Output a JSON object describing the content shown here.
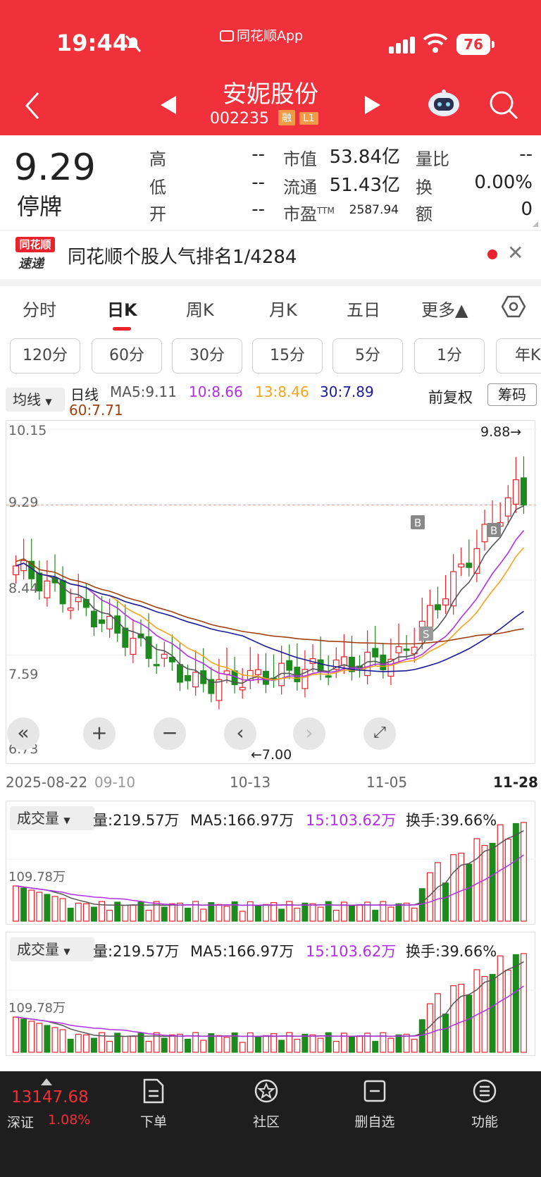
{
  "status": {
    "time": "19:44",
    "app_name": "同花顺App",
    "battery": "76"
  },
  "header": {
    "title": "安妮股份",
    "code": "002235",
    "badge1": "融",
    "badge2": "L1"
  },
  "quote": {
    "price": "9.29",
    "state": "停牌",
    "rows": [
      {
        "l1": "高",
        "v1": "--",
        "l2": "市值",
        "v2": "53.84亿",
        "l3": "量比",
        "v3": "--"
      },
      {
        "l1": "低",
        "v1": "--",
        "l2": "流通",
        "v2": "51.43亿",
        "l3": "换",
        "v3": "0.00%"
      },
      {
        "l1": "开",
        "v1": "--",
        "l2": "市盈",
        "v2": "2587.94",
        "l3": "额",
        "v3": "0"
      }
    ],
    "pe_sup": "TTM"
  },
  "popularity": {
    "logo_top": "同花顺",
    "logo_bottom": "速递",
    "text": "同花顺个股人气排名1/4284"
  },
  "tabs": [
    "分时",
    "日K",
    "周K",
    "月K",
    "五日",
    "更多▲"
  ],
  "minute_buttons": [
    "120分",
    "60分",
    "30分",
    "15分",
    "5分",
    "1分",
    "年K"
  ],
  "ma_bar": {
    "selector": "均线",
    "label": "日线",
    "ma5": "MA5:9.11",
    "ma10": "10:8.66",
    "ma13": "13:8.46",
    "ma30": "30:7.89",
    "ma60": "60:7.71",
    "adjust": "前复权",
    "chip": "筹码"
  },
  "kchart": {
    "y_labels": [
      "10.15",
      "9.29",
      "8.44",
      "7.59",
      "6.73"
    ],
    "max_label": "9.88→",
    "min_label": "←7.00",
    "x_labels": [
      "2025-08-22",
      "09-10",
      "10-13",
      "11-05",
      "11-28"
    ],
    "marker_b": "B",
    "marker_s": "S"
  },
  "volume1": {
    "selector": "成交量",
    "vol": "量:219.57万",
    "ma5": "MA5:166.97万",
    "ma15": "15:103.62万",
    "turnover": "换手:39.66%",
    "ylabel": "109.78万"
  },
  "volume2": {
    "selector": "成交量",
    "vol": "量:219.57万",
    "ma5": "MA5:166.97万",
    "ma15": "15:103.62万",
    "turnover": "换手:39.66%",
    "ylabel": "109.78万"
  },
  "bottom": {
    "index_value": "13147.68",
    "index_name": "深证",
    "index_pct": "1.08%",
    "nav": [
      "下单",
      "社区",
      "删自选",
      "功能"
    ]
  },
  "colors": {
    "up": "#e8232b",
    "down": "#1c8a1c",
    "ma5": "#555555",
    "ma10": "#b030e8",
    "ma13": "#f5a41c",
    "ma30": "#1a1a9a",
    "ma60": "#a0400f",
    "header_red": "#f0303a"
  }
}
